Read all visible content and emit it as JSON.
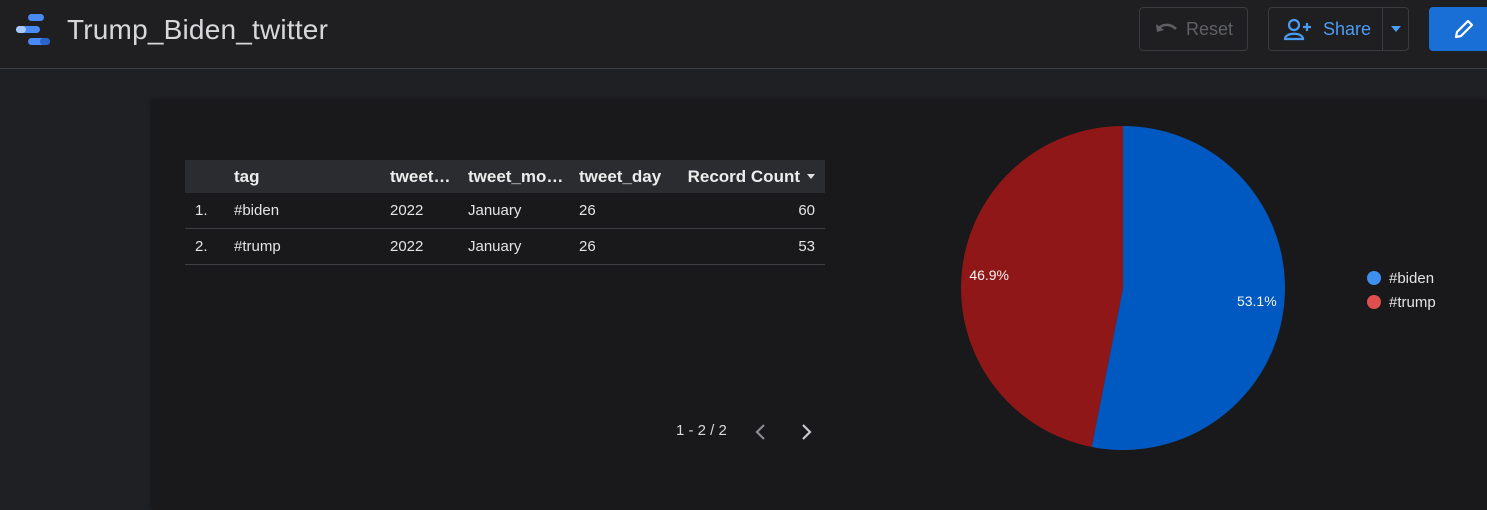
{
  "header": {
    "title": "Trump_Biden_twitter",
    "reset_label": "Reset",
    "share_label": "Share"
  },
  "table": {
    "columns": [
      "tag",
      "tweet…",
      "tweet_mo…",
      "tweet_day",
      "Record Count"
    ],
    "rows": [
      {
        "idx": "1.",
        "tag": "#biden",
        "year": "2022",
        "month": "January",
        "day": "26",
        "count": "60"
      },
      {
        "idx": "2.",
        "tag": "#trump",
        "year": "2022",
        "month": "January",
        "day": "26",
        "count": "53"
      }
    ],
    "pagination": "1 - 2 / 2"
  },
  "chart_data": {
    "type": "pie",
    "title": "",
    "slices": [
      {
        "label": "#biden",
        "value": 60,
        "percent_label": "53.1%",
        "color": "#0059c1"
      },
      {
        "label": "#trump",
        "value": 53,
        "percent_label": "46.9%",
        "color": "#8f1718"
      }
    ],
    "legend": [
      {
        "label": "#biden",
        "color": "#3f8ff0"
      },
      {
        "label": "#trump",
        "color": "#e04f4f"
      }
    ],
    "legend_placement": "right"
  },
  "colors": {
    "accent": "#1a6fd6",
    "share_text": "#4b9cf5"
  }
}
